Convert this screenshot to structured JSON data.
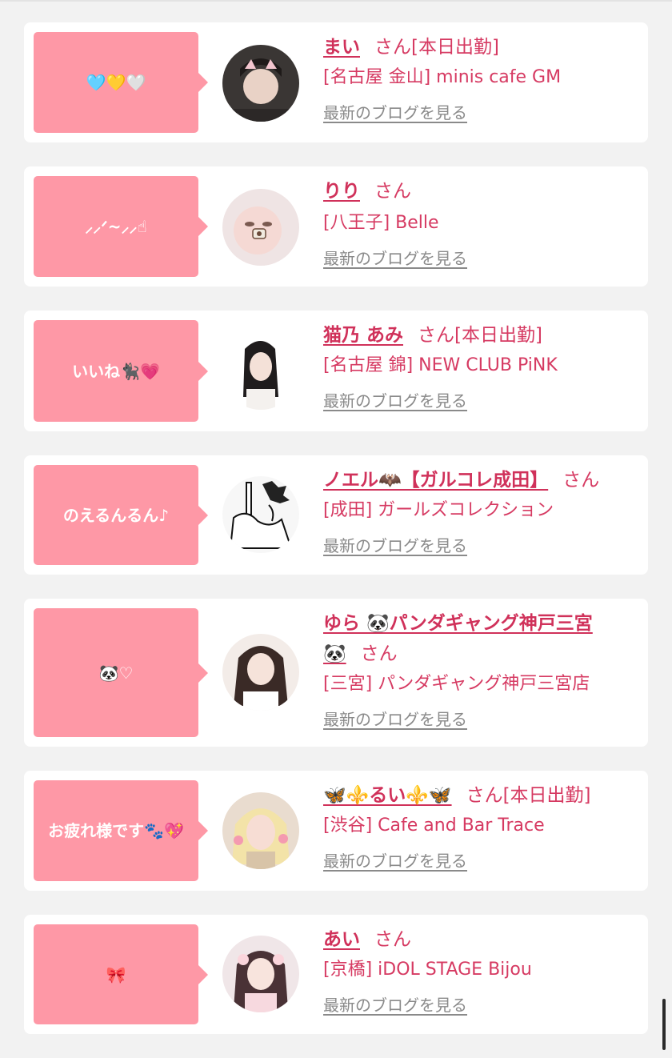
{
  "suffix": "さん",
  "blog_link": "最新のブログを見る",
  "cards": [
    {
      "bubble": "🩵💛🤍",
      "name": "まい",
      "status": "[本日出勤]",
      "shop": "[名古屋 金山] minis cafe GM",
      "avatar": "avatar-photo"
    },
    {
      "bubble": "⸝⸝ᐟ~⸝⸝☝︎",
      "name": "りり",
      "status": "",
      "shop": "[八王子] Belle",
      "avatar": "avatar-photo"
    },
    {
      "bubble": "いいね🐈‍⬛💗",
      "name": "猫乃 あみ",
      "status": "[本日出勤]",
      "shop": "[名古屋 錦] NEW CLUB PiNK",
      "avatar": "avatar-photo"
    },
    {
      "bubble": "のえるんるん♪",
      "name": "ノエル🦇【ガルコレ成田】",
      "status": "",
      "shop": "[成田] ガールズコレクション",
      "avatar": "avatar-manga"
    },
    {
      "bubble": "🐼♡",
      "name": "ゆら 🐼パンダギャング神戸三宮",
      "name_cont": "🐼",
      "status": "",
      "shop": "[三宮] パンダギャング神戸三宮店",
      "avatar": "avatar-photo"
    },
    {
      "bubble": "お疲れ様です🐾💖",
      "name": "🦋⚜️るい⚜️🦋",
      "status": "[本日出勤]",
      "shop": "[渋谷] Cafe and Bar Trace",
      "avatar": "avatar-photo"
    },
    {
      "bubble": "🎀",
      "name": "あい",
      "status": "",
      "shop": "[京橋] iDOL STAGE Bijou",
      "avatar": "avatar-photo"
    }
  ],
  "colors": {
    "accent": "#d0315a",
    "bubble": "#fe98a6",
    "link_gray": "#8a8a8a",
    "background": "#f2f2f2"
  }
}
